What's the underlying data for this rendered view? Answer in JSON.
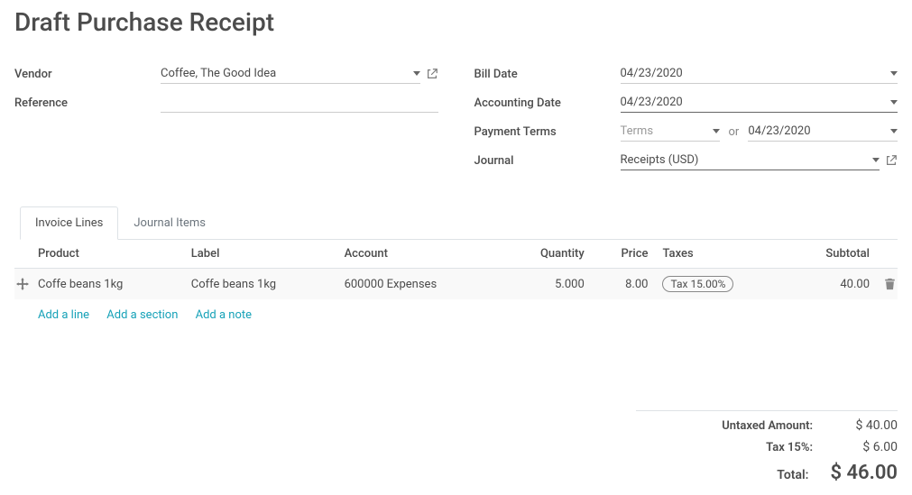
{
  "title": "Draft Purchase Receipt",
  "fields": {
    "vendor_label": "Vendor",
    "vendor_value": "Coffee, The Good Idea",
    "reference_label": "Reference",
    "reference_value": "",
    "bill_date_label": "Bill Date",
    "bill_date_value": "04/23/2020",
    "accounting_date_label": "Accounting Date",
    "accounting_date_value": "04/23/2020",
    "payment_terms_label": "Payment Terms",
    "payment_terms_placeholder": "Terms",
    "payment_terms_or": "or",
    "payment_terms_date": "04/23/2020",
    "journal_label": "Journal",
    "journal_value": "Receipts (USD)"
  },
  "tabs": {
    "invoice_lines": "Invoice Lines",
    "journal_items": "Journal Items"
  },
  "table": {
    "headers": {
      "product": "Product",
      "label": "Label",
      "account": "Account",
      "quantity": "Quantity",
      "price": "Price",
      "taxes": "Taxes",
      "subtotal": "Subtotal"
    },
    "row": {
      "product": "Coffe beans 1kg",
      "label": "Coffe beans 1kg",
      "account": "600000 Expenses",
      "quantity": "5.000",
      "price": "8.00",
      "tax": "Tax 15.00%",
      "subtotal": "40.00"
    },
    "add_line": "Add a line",
    "add_section": "Add a section",
    "add_note": "Add a note"
  },
  "totals": {
    "untaxed_label": "Untaxed Amount:",
    "untaxed_value": "$ 40.00",
    "tax_label": "Tax 15%:",
    "tax_value": "$ 6.00",
    "total_label": "Total:",
    "total_value": "$ 46.00"
  }
}
